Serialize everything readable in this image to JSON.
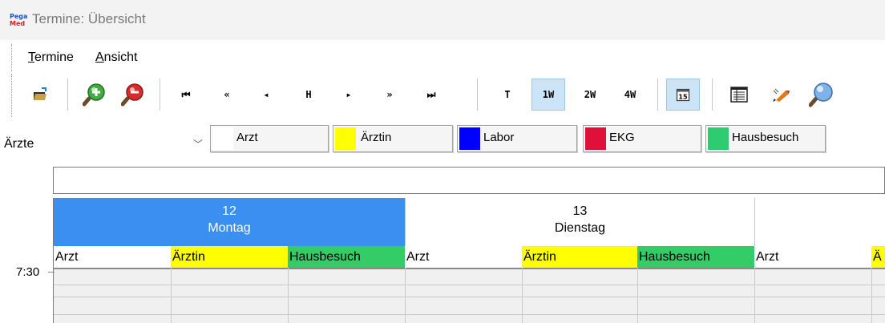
{
  "window": {
    "logo_line1": "Pega",
    "logo_line2": "Med",
    "title": "Termine: Übersicht"
  },
  "menu": {
    "items": [
      {
        "first": "T",
        "rest": "ermine"
      },
      {
        "first": "A",
        "rest": "nsicht"
      }
    ]
  },
  "toolbar": {
    "nav": [
      "⏮",
      "«",
      "◂",
      "H",
      "▸",
      "»",
      "⏭"
    ],
    "views": [
      "T",
      "1W",
      "2W",
      "4W"
    ],
    "active_view": "1W",
    "calendar_day_icon": "15"
  },
  "filter": {
    "selected": "Ärzte",
    "legend": [
      {
        "label": "Arzt",
        "color": "#ffffff"
      },
      {
        "label": "Ärztin",
        "color": "#ffff00"
      },
      {
        "label": "Labor",
        "color": "#0000ff"
      },
      {
        "label": "EKG",
        "color": "#e0103a"
      },
      {
        "label": "Hausbesuch",
        "color": "#2ecc71"
      }
    ]
  },
  "calendar": {
    "days": [
      {
        "date": "12",
        "weekday": "Montag",
        "selected": true
      },
      {
        "date": "13",
        "weekday": "Dienstag",
        "selected": false
      }
    ],
    "columns": [
      "Arzt",
      "Ärztin",
      "Hausbesuch",
      "Arzt",
      "Ärztin",
      "Hausbesuch",
      "Arzt",
      "Ä"
    ],
    "column_colors": {
      "Arzt": "#ffffff",
      "Ärztin": "#ffff00",
      "Hausbesuch": "#33cc66"
    },
    "time_start": "7:30"
  }
}
